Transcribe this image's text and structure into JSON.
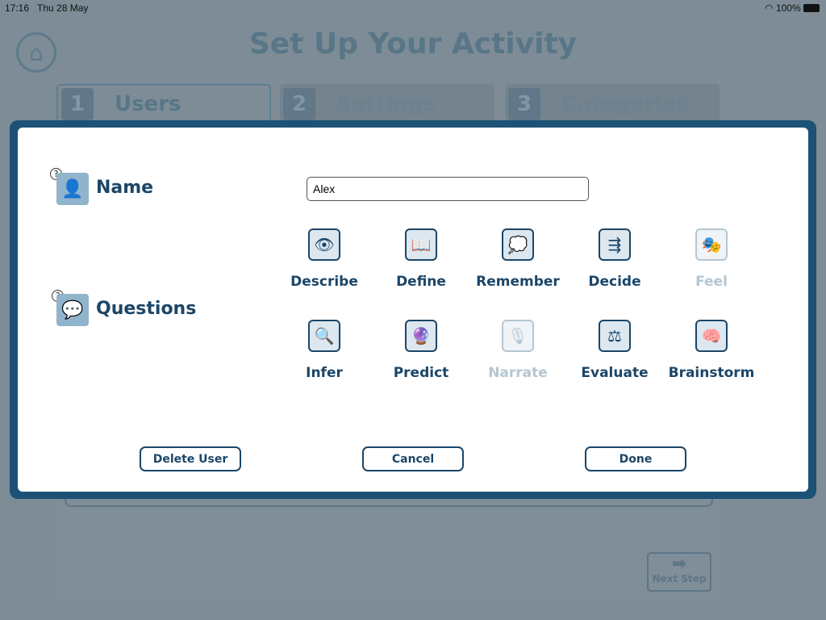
{
  "status": {
    "time": "17:16",
    "date": "Thu 28 May",
    "battery": "100%"
  },
  "background": {
    "title": "Set Up Your Activity",
    "tabs": [
      {
        "num": "1",
        "label": "Users"
      },
      {
        "num": "2",
        "label": "Settings"
      },
      {
        "num": "3",
        "label": "Categories"
      }
    ],
    "next_step": "Next Step"
  },
  "modal": {
    "name_label": "Name",
    "name_value": "Alex",
    "help": "?",
    "questions_label": "Questions",
    "questions": [
      {
        "label": "Describe",
        "icon": "eye-icon",
        "enabled": true
      },
      {
        "label": "Define",
        "icon": "book-icon",
        "enabled": true
      },
      {
        "label": "Remember",
        "icon": "thought-bubble-icon",
        "enabled": true
      },
      {
        "label": "Decide",
        "icon": "decision-arrows-icon",
        "enabled": true
      },
      {
        "label": "Feel",
        "icon": "theatre-masks-icon",
        "enabled": false
      },
      {
        "label": "Infer",
        "icon": "magnifier-icon",
        "enabled": true
      },
      {
        "label": "Predict",
        "icon": "crystal-ball-icon",
        "enabled": true
      },
      {
        "label": "Narrate",
        "icon": "microphone-icon",
        "enabled": false
      },
      {
        "label": "Evaluate",
        "icon": "scales-icon",
        "enabled": true
      },
      {
        "label": "Brainstorm",
        "icon": "brain-icon",
        "enabled": true
      }
    ],
    "buttons": {
      "delete": "Delete User",
      "cancel": "Cancel",
      "done": "Done"
    }
  },
  "colors": {
    "accent": "#1b5275",
    "text": "#1b4668",
    "disabled": "#b5c6d1"
  }
}
